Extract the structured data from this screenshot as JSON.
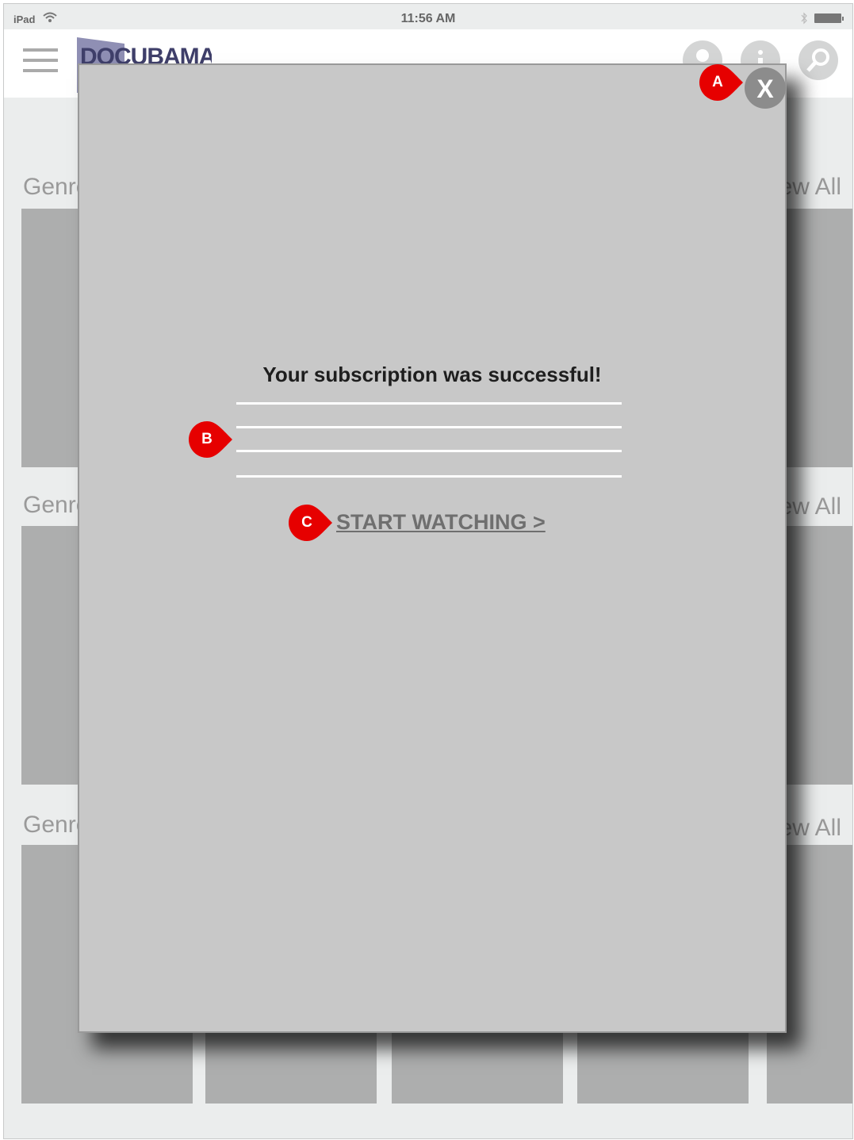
{
  "status_bar": {
    "device": "iPad",
    "time": "11:56 AM"
  },
  "header": {
    "logo_text": "DOCUBAMA",
    "icons": [
      "user-icon",
      "info-icon",
      "search-icon"
    ]
  },
  "sections": [
    {
      "title": "Genre",
      "view_all": "View All"
    },
    {
      "title": "Genre",
      "view_all": "View All"
    },
    {
      "title": "Genre",
      "view_all": "View All"
    }
  ],
  "modal": {
    "close_label": "X",
    "title": "Your subscription was successful!",
    "placeholder_lines": 4,
    "cta_label": "START WATCHING >"
  },
  "annotations": [
    "A",
    "B",
    "C"
  ],
  "colors": {
    "marker": "#e60000",
    "modal_bg": "#c8c8c8",
    "tile": "#adaeae",
    "logo": "#8f8fb4"
  }
}
